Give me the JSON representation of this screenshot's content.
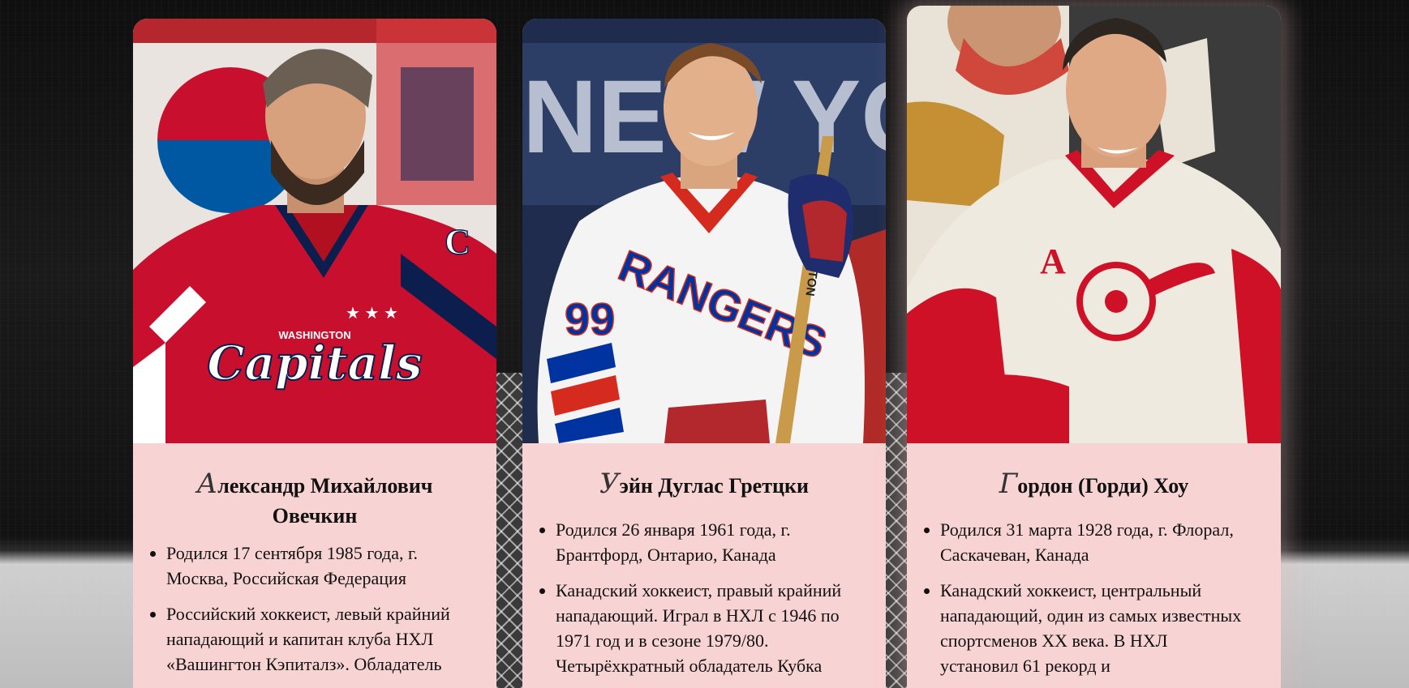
{
  "cards": [
    {
      "name_initial": "А",
      "name_rest": "лександр Михайлович Овечкин",
      "facts": [
        "Родился 17 сентября 1985 года, г. Москва, Российская Федерация",
        "Российский хоккеист, левый крайний нападающий и капитан клуба НХЛ «Вашингтон Кэпиталз». Обладатель"
      ],
      "photo": {
        "jersey_text": "Capitals",
        "jersey_subtext": "WASHINGTON",
        "captain_letter": "C",
        "jersey_color": "#c8102e",
        "background_logo": "PEPSI"
      }
    },
    {
      "name_initial": "У",
      "name_rest": "эйн Дуглас Гретцки",
      "facts": [
        "Родился 26 января 1961 года, г. Брантфорд, Онтарио, Канада",
        "Канадский хоккеист, правый крайний нападающий. Играл в НХЛ с 1946 по 1971 год и в сезоне 1979/80. Четырёхкратный обладатель Кубка"
      ],
      "photo": {
        "jersey_text": "RANGERS",
        "jersey_number": "99",
        "banner_text": "NEW YOR",
        "stick_brand": "EASTON",
        "jersey_color": "#f4f4f4",
        "accent_color": "#0033a0"
      }
    },
    {
      "name_initial": "Г",
      "name_rest": "ордон (Горди) Хоу",
      "facts": [
        "Родился 31 марта 1928 года, г. Флорал, Саскачеван, Канада",
        "Канадский хоккеист, центральный нападающий, один из самых известных спортсменов XX века. В НХЛ установил 61 рекорд и"
      ],
      "photo": {
        "alternate_letter": "A",
        "jersey_color": "#eeeae0",
        "accent_color": "#ce1126"
      }
    }
  ]
}
